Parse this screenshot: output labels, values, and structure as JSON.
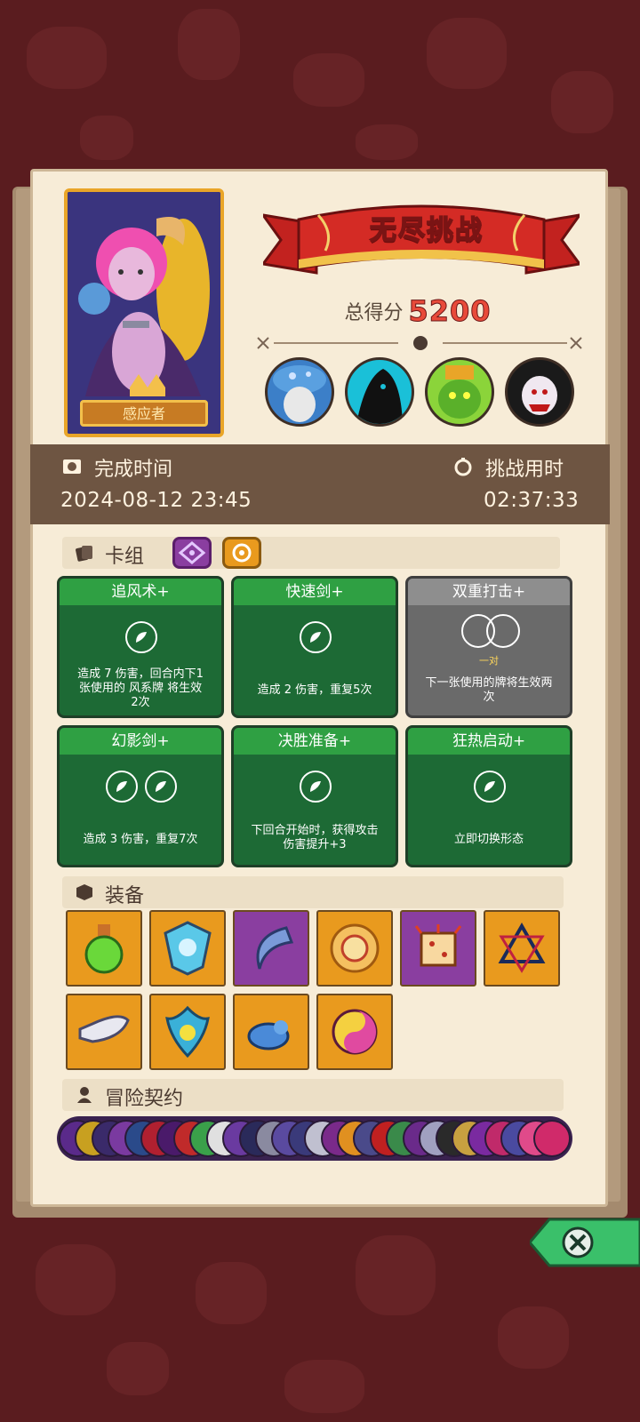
{
  "mode_title": "无尽挑战",
  "character": {
    "name": "感应者"
  },
  "score": {
    "label": "总得分",
    "value": "5200"
  },
  "bosses": [
    {
      "icon": "mushroom-elder-boss-icon",
      "color": "#3c7fc8"
    },
    {
      "icon": "shadow-demon-boss-icon",
      "color": "#1ac0d8"
    },
    {
      "icon": "green-goblin-king-boss-icon",
      "color": "#8bd43a"
    },
    {
      "icon": "vampire-boss-icon",
      "color": "#1a1a1a"
    }
  ],
  "time": {
    "completion_label": "完成时间",
    "completion_value": "2024-08-12 23:45",
    "duration_label": "挑战用时",
    "duration_value": "02:37:33"
  },
  "deck": {
    "label": "卡组",
    "tags": [
      {
        "icon": "purple-rune-tag-icon",
        "color": "#8a3ea0"
      },
      {
        "icon": "orange-swirl-tag-icon",
        "color": "#e99a1e"
      }
    ],
    "cards": [
      {
        "title": "追风术+",
        "style": "green",
        "desc_lines": [
          "造成 7 伤害，回合内下1",
          "张使用的 风系牌 将生效",
          "2次"
        ]
      },
      {
        "title": "快速剑+",
        "style": "green",
        "desc_lines": [
          "造成 2 伤害，重复5次"
        ]
      },
      {
        "title": "双重打击+",
        "style": "gray",
        "note": "一对",
        "desc_lines": [
          "下一张使用的牌将生效两",
          "次"
        ]
      },
      {
        "title": "幻影剑+",
        "style": "green",
        "desc_lines": [
          "造成 3 伤害，重复7次"
        ]
      },
      {
        "title": "决胜准备+",
        "style": "green",
        "desc_lines": [
          "下回合开始时，获得攻击",
          "伤害提升+3"
        ]
      },
      {
        "title": "狂热启动+",
        "style": "green",
        "desc_lines": [
          "立即切换形态"
        ]
      }
    ]
  },
  "equipment": {
    "label": "装备",
    "items": [
      {
        "icon": "green-potion-icon",
        "bg": "orange"
      },
      {
        "icon": "crystal-shield-icon",
        "bg": "orange"
      },
      {
        "icon": "crescent-blade-icon",
        "bg": "purple"
      },
      {
        "icon": "golden-coin-icon",
        "bg": "orange"
      },
      {
        "icon": "spiked-dice-icon",
        "bg": "purple"
      },
      {
        "icon": "hexagram-amulet-icon",
        "bg": "orange"
      },
      {
        "icon": "horn-icon",
        "bg": "orange"
      },
      {
        "icon": "flame-mask-icon",
        "bg": "orange"
      },
      {
        "icon": "blue-slime-icon",
        "bg": "orange"
      },
      {
        "icon": "yin-yang-orb-icon",
        "bg": "orange"
      }
    ]
  },
  "contracts": {
    "label": "冒险契约",
    "colors": [
      "#5a2a8a",
      "#c8a020",
      "#3a2a6a",
      "#7a3aa0",
      "#2a4a8a",
      "#b02030",
      "#4a1a6a",
      "#c02a2a",
      "#3aa04a",
      "#e0e0e0",
      "#6a3aa0",
      "#2a2a5a",
      "#8a8aa0",
      "#5a4aa0",
      "#3a3a7a",
      "#c0c0d0",
      "#7a2a8a",
      "#e09020",
      "#4a4a8a",
      "#c02020",
      "#3a8a4a",
      "#6a2a8a",
      "#a0a0c0",
      "#2a2a2a",
      "#c8a040",
      "#7a2aa0",
      "#c02a6a",
      "#4a4aa0",
      "#e04a8a",
      "#d02a6a"
    ]
  },
  "close_icon": "close-x-icon"
}
